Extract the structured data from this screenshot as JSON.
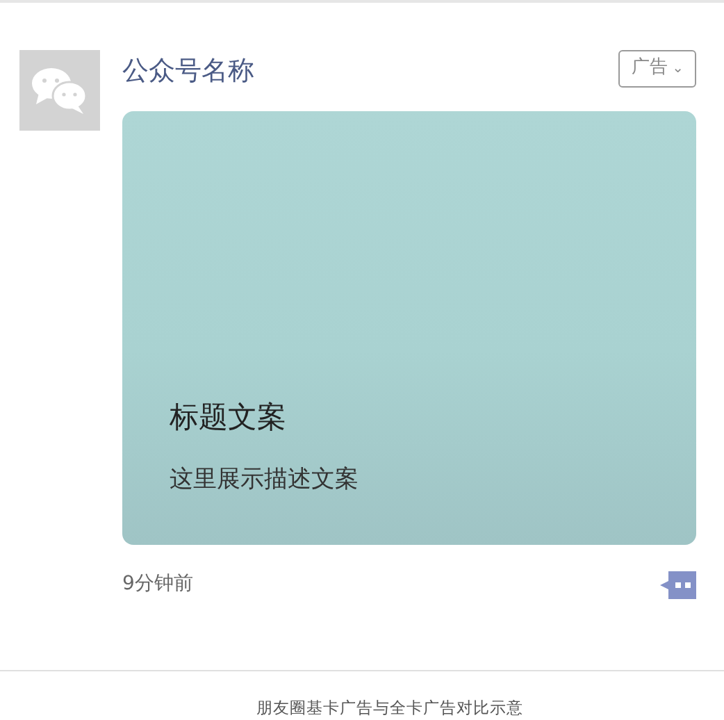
{
  "post": {
    "account_name": "公众号名称",
    "ad_tag": "广告",
    "ad_caret": "⌄",
    "card": {
      "title": "标题文案",
      "description": "这里展示描述文案"
    },
    "time": "9分钟前"
  },
  "caption": "朋友圈基卡广告与全卡广告对比示意"
}
